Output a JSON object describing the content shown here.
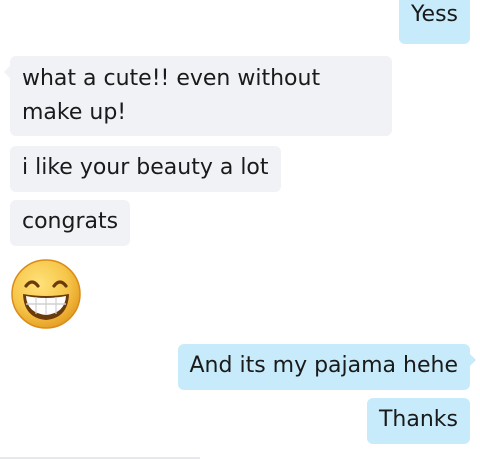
{
  "messages": {
    "out_1": "Yess",
    "in_1": "what a cute!! even without make up!",
    "in_2": "i like your beauty a lot",
    "in_3": "congrats",
    "emoji": "grinning-smiley",
    "out_2": "And its my pajama hehe",
    "out_3": "Thanks"
  },
  "colors": {
    "incoming_bubble": "#f0f2f6",
    "outgoing_bubble": "#c7ebfa",
    "emoji_face": "#f6c64a"
  }
}
